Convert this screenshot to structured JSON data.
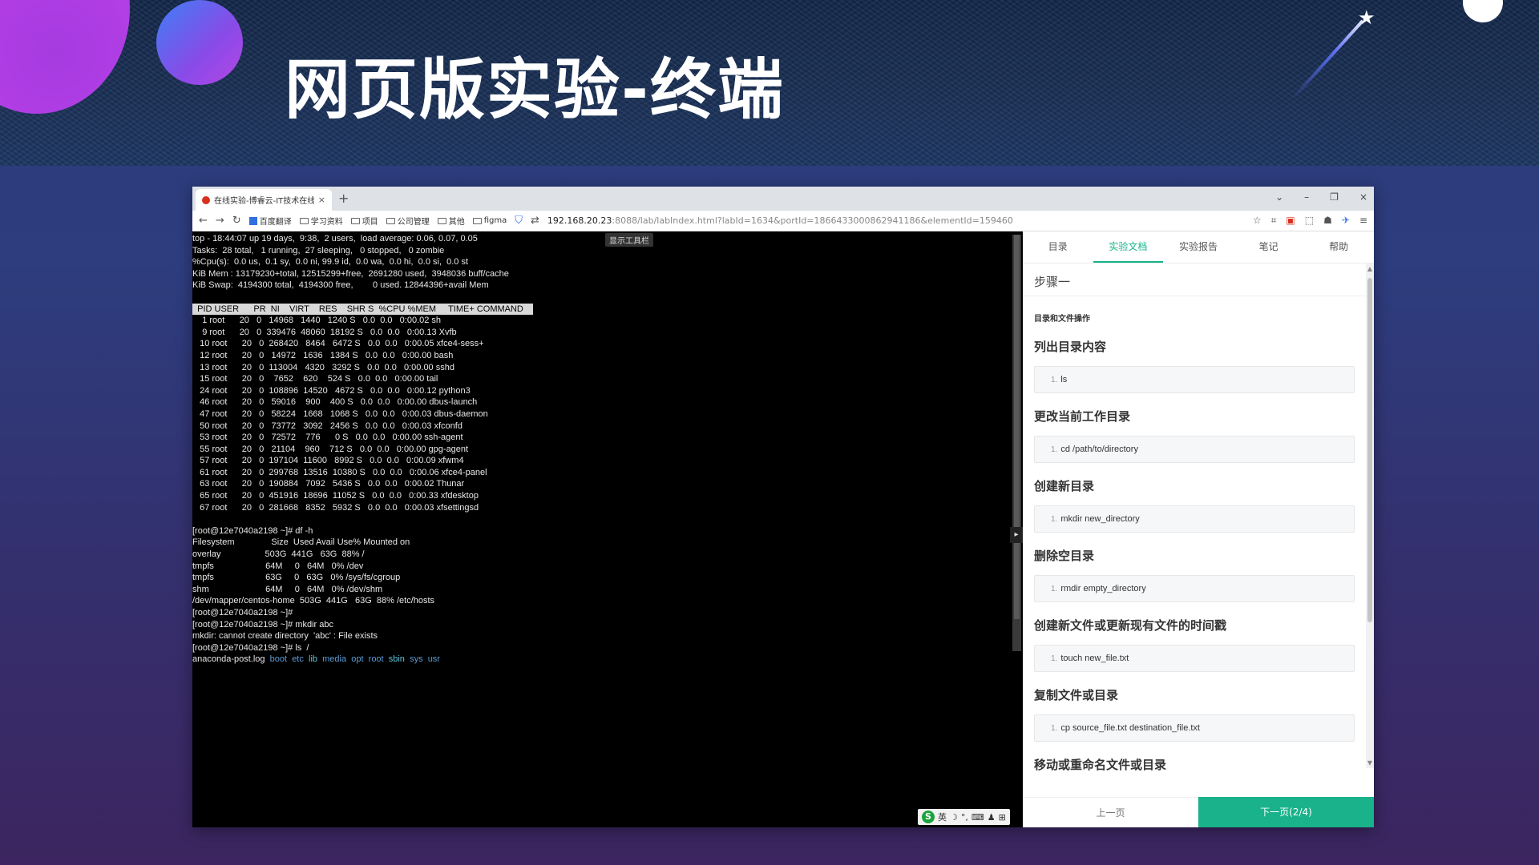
{
  "slide": {
    "title": "网页版实验-终端"
  },
  "browser": {
    "tab_title": "在线实验-博睿云-IT技术在线教",
    "tab_close": "×",
    "new_tab": "+",
    "window_controls": [
      "⌄",
      "–",
      "❐",
      "×"
    ],
    "bookmarks": [
      "百度翻译",
      "学习资料",
      "项目",
      "公司管理",
      "其他",
      "figma"
    ],
    "url_host": "192.168.20.23",
    "url_rest": ":8088/lab/labIndex.html?labId=1634&portId=1866433000862941186&elementId=159460"
  },
  "terminal": {
    "show_toolbar_label": "显示工具栏",
    "top_lines": [
      "top - 18:44:07 up 19 days,  9:38,  2 users,  load average: 0.06, 0.07, 0.05",
      "Tasks:  28 total,   1 running,  27 sleeping,   0 stopped,   0 zombie",
      "%Cpu(s):  0.0 us,  0.1 sy,  0.0 ni, 99.9 id,  0.0 wa,  0.0 hi,  0.0 si,  0.0 st",
      "KiB Mem : 13179230+total, 12515299+free,  2691280 used,  3948036 buff/cache",
      "KiB Swap:  4194300 total,  4194300 free,        0 used. 12844396+avail Mem",
      ""
    ],
    "process_header": "  PID USER      PR  NI    VIRT    RES    SHR S  %CPU %MEM     TIME+ COMMAND",
    "processes": [
      "    1 root      20   0   14968   1440   1240 S   0.0  0.0   0:00.02 sh",
      "    9 root      20   0  339476  48060  18192 S   0.0  0.0   0:00.13 Xvfb",
      "   10 root      20   0  268420   8464   6472 S   0.0  0.0   0:00.05 xfce4-sess+",
      "   12 root      20   0   14972   1636   1384 S   0.0  0.0   0:00.00 bash",
      "   13 root      20   0  113004   4320   3292 S   0.0  0.0   0:00.00 sshd",
      "   15 root      20   0    7652    620    524 S   0.0  0.0   0:00.00 tail",
      "   24 root      20   0  108896  14520   4672 S   0.0  0.0   0:00.12 python3",
      "   46 root      20   0   59016    900    400 S   0.0  0.0   0:00.00 dbus-launch",
      "   47 root      20   0   58224   1668   1068 S   0.0  0.0   0:00.03 dbus-daemon",
      "   50 root      20   0   73772   3092   2456 S   0.0  0.0   0:00.03 xfconfd",
      "   53 root      20   0   72572    776      0 S   0.0  0.0   0:00.00 ssh-agent",
      "   55 root      20   0   21104    960    712 S   0.0  0.0   0:00.00 gpg-agent",
      "   57 root      20   0  197104  11600   8992 S   0.0  0.0   0:00.09 xfwm4",
      "   61 root      20   0  299768  13516  10380 S   0.0  0.0   0:00.06 xfce4-panel",
      "   63 root      20   0  190884   7092   5436 S   0.0  0.0   0:00.02 Thunar",
      "   65 root      20   0  451916  18696  11052 S   0.0  0.0   0:00.33 xfdesktop",
      "   67 root      20   0  281668   8352   5932 S   0.0  0.0   0:00.03 xfsettingsd"
    ],
    "after_lines": [
      "",
      "[root@12e7040a2198 ~]# df -h",
      "Filesystem               Size  Used Avail Use% Mounted on",
      "overlay                  503G  441G   63G  88% /",
      "tmpfs                     64M     0   64M   0% /dev",
      "tmpfs                     63G     0   63G   0% /sys/fs/cgroup",
      "shm                       64M     0   64M   0% /dev/shm",
      "/dev/mapper/centos-home  503G  441G   63G  88% /etc/hosts",
      "[root@12e7040a2198 ~]#",
      "[root@12e7040a2198 ~]# mkdir abc",
      "mkdir: cannot create directory  'abc' : File exists",
      "[root@12e7040a2198 ~]# ls  /"
    ],
    "ls_file": "anaconda-post.log",
    "ls_dirs": [
      "boot",
      "etc",
      "lib",
      "media",
      "opt",
      "root",
      "sbin",
      "sys",
      "usr"
    ],
    "ime_label": "英"
  },
  "panel": {
    "tabs": [
      "目录",
      "实验文档",
      "实验报告",
      "笔记",
      "帮助"
    ],
    "step_title": "步骤一",
    "section_title": "目录和文件操作",
    "items": [
      {
        "heading": "列出目录内容",
        "code": "ls"
      },
      {
        "heading": "更改当前工作目录",
        "code": "cd /path/to/directory"
      },
      {
        "heading": "创建新目录",
        "code": "mkdir new_directory"
      },
      {
        "heading": "删除空目录",
        "code": "rmdir empty_directory"
      },
      {
        "heading": "创建新文件或更新现有文件的时间戳",
        "code": "touch new_file.txt"
      },
      {
        "heading": "复制文件或目录",
        "code": "cp source_file.txt destination_file.txt"
      }
    ],
    "last_heading": "移动或重命名文件或目录",
    "code_line_number": "1.",
    "prev_label": "上一页",
    "next_label": "下一页(2/4)"
  },
  "colors": {
    "accent": "#19b28a",
    "terminal_bg": "#000000",
    "dir": "#5b9bd5"
  }
}
